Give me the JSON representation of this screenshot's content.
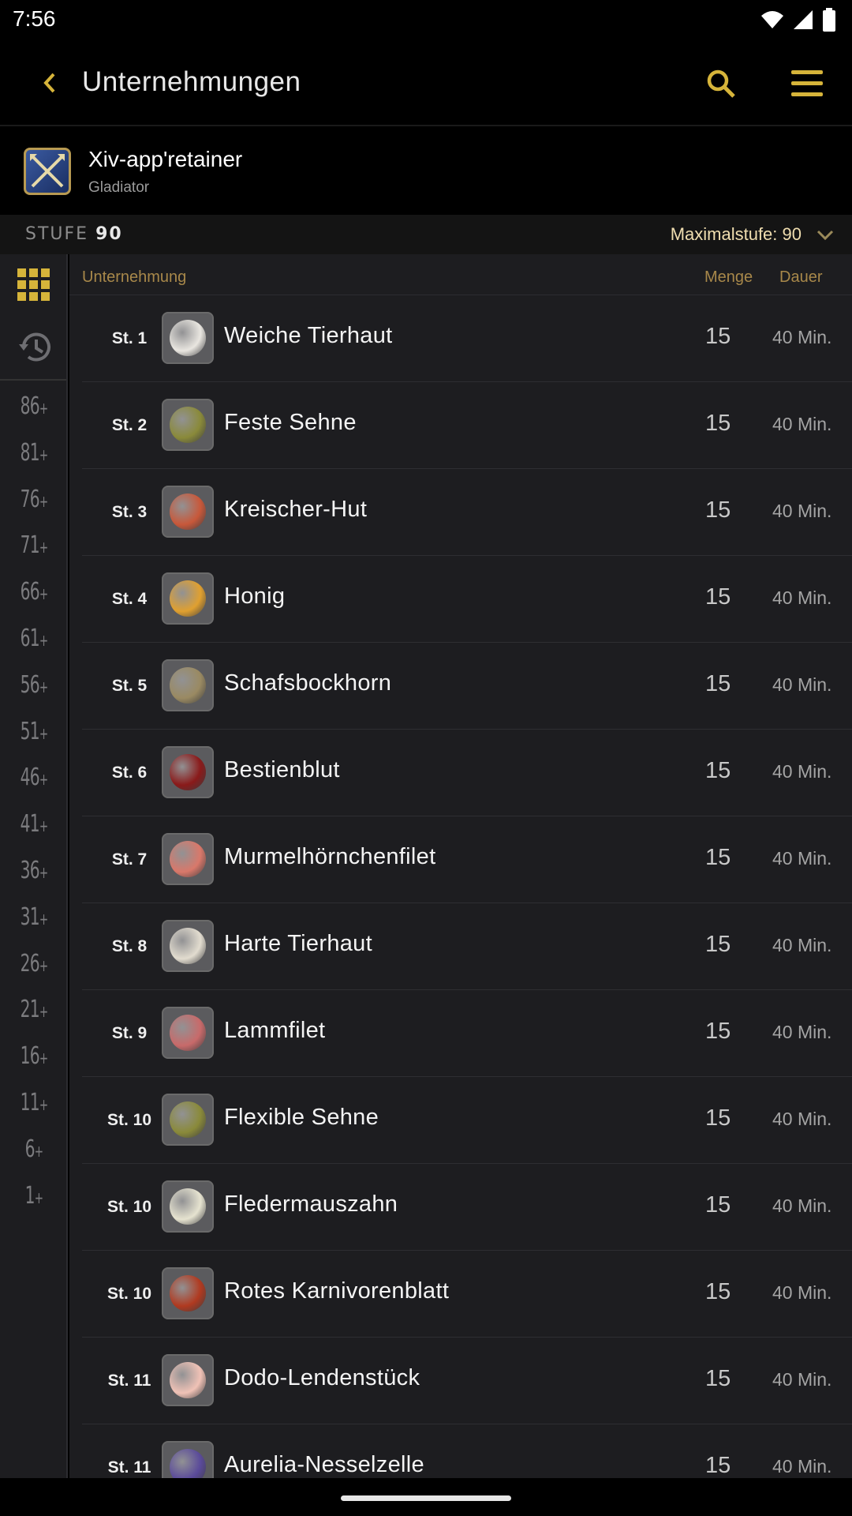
{
  "status": {
    "time": "7:56"
  },
  "appbar": {
    "title": "Unternehmungen"
  },
  "character": {
    "name": "Xiv-app'retainer",
    "job": "Gladiator"
  },
  "levelbar": {
    "stufe_label": "STUFE",
    "stufe_value": "90",
    "max_label": "Maximalstufe: 90"
  },
  "sidebar": {
    "levels": [
      "86+",
      "81+",
      "76+",
      "71+",
      "66+",
      "61+",
      "56+",
      "51+",
      "46+",
      "41+",
      "36+",
      "31+",
      "26+",
      "21+",
      "16+",
      "11+",
      "6+",
      "1+"
    ]
  },
  "list": {
    "headers": {
      "name": "Unternehmung",
      "qty": "Menge",
      "duration": "Dauer"
    },
    "rows": [
      {
        "level": "St. 1",
        "name": "Weiche Tierhaut",
        "qty": "15",
        "duration": "40 Min.",
        "icon": "hide-icon",
        "color": "#e9e6e0"
      },
      {
        "level": "St. 2",
        "name": "Feste Sehne",
        "qty": "15",
        "duration": "40 Min.",
        "icon": "sinew-icon",
        "color": "#8a8a3a"
      },
      {
        "level": "St. 3",
        "name": "Kreischer-Hut",
        "qty": "15",
        "duration": "40 Min.",
        "icon": "mushroom-icon",
        "color": "#c8583a"
      },
      {
        "level": "St. 4",
        "name": "Honig",
        "qty": "15",
        "duration": "40 Min.",
        "icon": "honey-icon",
        "color": "#e0a030"
      },
      {
        "level": "St. 5",
        "name": "Schafsbockhorn",
        "qty": "15",
        "duration": "40 Min.",
        "icon": "horn-icon",
        "color": "#9a8a62"
      },
      {
        "level": "St. 6",
        "name": "Bestienblut",
        "qty": "15",
        "duration": "40 Min.",
        "icon": "blood-icon",
        "color": "#8a1a1a"
      },
      {
        "level": "St. 7",
        "name": "Murmelhörnchenfilet",
        "qty": "15",
        "duration": "40 Min.",
        "icon": "meat-icon",
        "color": "#d9786a"
      },
      {
        "level": "St. 8",
        "name": "Harte Tierhaut",
        "qty": "15",
        "duration": "40 Min.",
        "icon": "hide-icon",
        "color": "#e2dccf"
      },
      {
        "level": "St. 9",
        "name": "Lammfilet",
        "qty": "15",
        "duration": "40 Min.",
        "icon": "meat-icon",
        "color": "#c86a6a"
      },
      {
        "level": "St. 10",
        "name": "Flexible Sehne",
        "qty": "15",
        "duration": "40 Min.",
        "icon": "sinew-icon",
        "color": "#8a8a3a"
      },
      {
        "level": "St. 10",
        "name": "Fledermauszahn",
        "qty": "15",
        "duration": "40 Min.",
        "icon": "fang-icon",
        "color": "#e6e3d0"
      },
      {
        "level": "St. 10",
        "name": "Rotes Karnivorenblatt",
        "qty": "15",
        "duration": "40 Min.",
        "icon": "leaf-icon",
        "color": "#b03a20"
      },
      {
        "level": "St. 11",
        "name": "Dodo-Lendenstück",
        "qty": "15",
        "duration": "40 Min.",
        "icon": "meat-icon",
        "color": "#f0c2b6"
      },
      {
        "level": "St. 11",
        "name": "Aurelia-Nesselzelle",
        "qty": "15",
        "duration": "40 Min.",
        "icon": "orb-icon",
        "color": "#5a4a9a"
      }
    ]
  },
  "colors": {
    "accent": "#d6b43a",
    "header_gold": "#a8884a",
    "background": "#1d1d20"
  }
}
